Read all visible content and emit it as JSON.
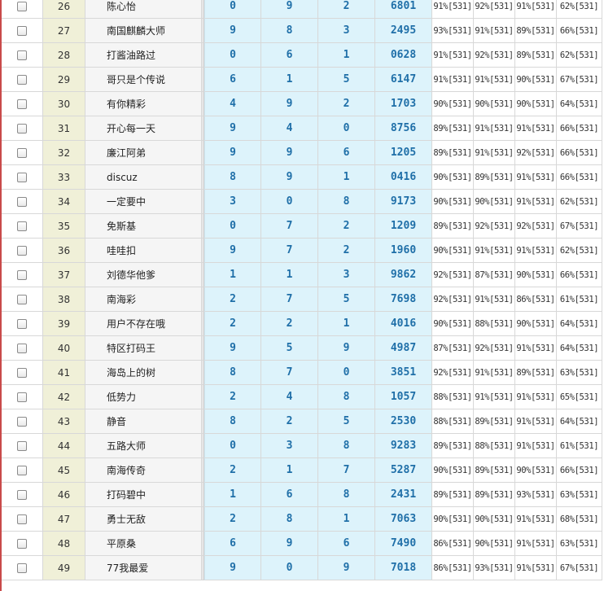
{
  "rows": [
    {
      "no": "26",
      "name": "陈心怡",
      "d1": "0",
      "d2": "9",
      "d3": "2",
      "code": "6801",
      "p1": "91%[531]",
      "p2": "92%[531]",
      "p3": "91%[531]",
      "p4": "62%[531]"
    },
    {
      "no": "27",
      "name": "南国麒麟大师",
      "d1": "9",
      "d2": "8",
      "d3": "3",
      "code": "2495",
      "p1": "93%[531]",
      "p2": "91%[531]",
      "p3": "89%[531]",
      "p4": "66%[531]"
    },
    {
      "no": "28",
      "name": "打酱油路过",
      "d1": "0",
      "d2": "6",
      "d3": "1",
      "code": "0628",
      "p1": "91%[531]",
      "p2": "92%[531]",
      "p3": "89%[531]",
      "p4": "62%[531]"
    },
    {
      "no": "29",
      "name": "哥只是个传说",
      "d1": "6",
      "d2": "1",
      "d3": "5",
      "code": "6147",
      "p1": "91%[531]",
      "p2": "91%[531]",
      "p3": "90%[531]",
      "p4": "67%[531]"
    },
    {
      "no": "30",
      "name": "有你精彩",
      "d1": "4",
      "d2": "9",
      "d3": "2",
      "code": "1703",
      "p1": "90%[531]",
      "p2": "90%[531]",
      "p3": "90%[531]",
      "p4": "64%[531]"
    },
    {
      "no": "31",
      "name": "开心每一天",
      "d1": "9",
      "d2": "4",
      "d3": "0",
      "code": "8756",
      "p1": "89%[531]",
      "p2": "91%[531]",
      "p3": "91%[531]",
      "p4": "66%[531]"
    },
    {
      "no": "32",
      "name": "廉江阿弟",
      "d1": "9",
      "d2": "9",
      "d3": "6",
      "code": "1205",
      "p1": "89%[531]",
      "p2": "91%[531]",
      "p3": "92%[531]",
      "p4": "66%[531]"
    },
    {
      "no": "33",
      "name": "discuz",
      "d1": "8",
      "d2": "9",
      "d3": "1",
      "code": "0416",
      "p1": "90%[531]",
      "p2": "89%[531]",
      "p3": "91%[531]",
      "p4": "66%[531]"
    },
    {
      "no": "34",
      "name": "一定要中",
      "d1": "3",
      "d2": "0",
      "d3": "8",
      "code": "9173",
      "p1": "90%[531]",
      "p2": "90%[531]",
      "p3": "91%[531]",
      "p4": "62%[531]"
    },
    {
      "no": "35",
      "name": "免斯基",
      "d1": "0",
      "d2": "7",
      "d3": "2",
      "code": "1209",
      "p1": "89%[531]",
      "p2": "92%[531]",
      "p3": "92%[531]",
      "p4": "67%[531]"
    },
    {
      "no": "36",
      "name": "哇哇扣",
      "d1": "9",
      "d2": "7",
      "d3": "2",
      "code": "1960",
      "p1": "90%[531]",
      "p2": "91%[531]",
      "p3": "91%[531]",
      "p4": "62%[531]"
    },
    {
      "no": "37",
      "name": "刘德华他爹",
      "d1": "1",
      "d2": "1",
      "d3": "3",
      "code": "9862",
      "p1": "92%[531]",
      "p2": "87%[531]",
      "p3": "90%[531]",
      "p4": "66%[531]"
    },
    {
      "no": "38",
      "name": "南海彩",
      "d1": "2",
      "d2": "7",
      "d3": "5",
      "code": "7698",
      "p1": "92%[531]",
      "p2": "91%[531]",
      "p3": "86%[531]",
      "p4": "61%[531]"
    },
    {
      "no": "39",
      "name": "用户不存在哦",
      "d1": "2",
      "d2": "2",
      "d3": "1",
      "code": "4016",
      "p1": "90%[531]",
      "p2": "88%[531]",
      "p3": "90%[531]",
      "p4": "64%[531]"
    },
    {
      "no": "40",
      "name": "特区打码王",
      "d1": "9",
      "d2": "5",
      "d3": "9",
      "code": "4987",
      "p1": "87%[531]",
      "p2": "92%[531]",
      "p3": "91%[531]",
      "p4": "64%[531]"
    },
    {
      "no": "41",
      "name": "海岛上的树",
      "d1": "8",
      "d2": "7",
      "d3": "0",
      "code": "3851",
      "p1": "92%[531]",
      "p2": "91%[531]",
      "p3": "89%[531]",
      "p4": "63%[531]"
    },
    {
      "no": "42",
      "name": "低势力",
      "d1": "2",
      "d2": "4",
      "d3": "8",
      "code": "1057",
      "p1": "88%[531]",
      "p2": "91%[531]",
      "p3": "91%[531]",
      "p4": "65%[531]"
    },
    {
      "no": "43",
      "name": "静音",
      "d1": "8",
      "d2": "2",
      "d3": "5",
      "code": "2530",
      "p1": "88%[531]",
      "p2": "89%[531]",
      "p3": "91%[531]",
      "p4": "64%[531]"
    },
    {
      "no": "44",
      "name": "五路大师",
      "d1": "0",
      "d2": "3",
      "d3": "8",
      "code": "9283",
      "p1": "89%[531]",
      "p2": "88%[531]",
      "p3": "91%[531]",
      "p4": "61%[531]"
    },
    {
      "no": "45",
      "name": "南海传奇",
      "d1": "2",
      "d2": "1",
      "d3": "7",
      "code": "5287",
      "p1": "90%[531]",
      "p2": "89%[531]",
      "p3": "90%[531]",
      "p4": "66%[531]"
    },
    {
      "no": "46",
      "name": "打码碧中",
      "d1": "1",
      "d2": "6",
      "d3": "8",
      "code": "2431",
      "p1": "89%[531]",
      "p2": "89%[531]",
      "p3": "93%[531]",
      "p4": "63%[531]"
    },
    {
      "no": "47",
      "name": "勇士无敌",
      "d1": "2",
      "d2": "8",
      "d3": "1",
      "code": "7063",
      "p1": "90%[531]",
      "p2": "90%[531]",
      "p3": "91%[531]",
      "p4": "68%[531]"
    },
    {
      "no": "48",
      "name": "平原桑",
      "d1": "6",
      "d2": "9",
      "d3": "6",
      "code": "7490",
      "p1": "86%[531]",
      "p2": "90%[531]",
      "p3": "91%[531]",
      "p4": "63%[531]"
    },
    {
      "no": "49",
      "name": "77我最爱",
      "d1": "9",
      "d2": "0",
      "d3": "9",
      "code": "7018",
      "p1": "86%[531]",
      "p2": "93%[531]",
      "p3": "91%[531]",
      "p4": "67%[531]"
    }
  ]
}
